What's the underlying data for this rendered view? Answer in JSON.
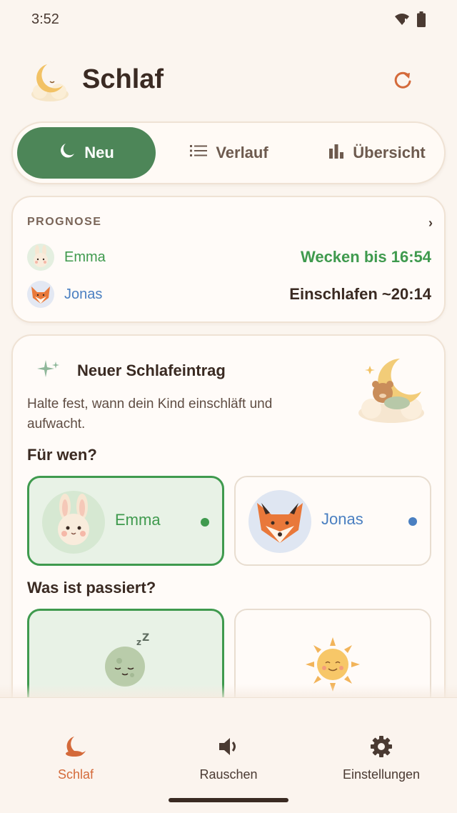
{
  "status_bar": {
    "time": "3:52",
    "wifi_icon": "wifi-icon",
    "battery_icon": "battery-icon"
  },
  "header": {
    "title": "Schlaf",
    "logo_icon": "moon-cloud-icon",
    "refresh_icon": "refresh-icon"
  },
  "tabs": [
    {
      "label": "Neu",
      "icon": "moon-icon",
      "active": true
    },
    {
      "label": "Verlauf",
      "icon": "list-icon",
      "active": false
    },
    {
      "label": "Übersicht",
      "icon": "bar-chart-icon",
      "active": false
    }
  ],
  "forecast": {
    "heading": "PROGNOSE",
    "rows": [
      {
        "name": "Emma",
        "prediction": "Wecken bis 16:54",
        "name_color": "#3f9a4e",
        "prediction_color": "#3f9a4e"
      },
      {
        "name": "Jonas",
        "prediction": "Einschlafen ~20:14",
        "name_color": "#4a7fc1",
        "prediction_color": "#3a2a22"
      }
    ]
  },
  "entry": {
    "title": "Neuer Schlafeintrag",
    "description": "Halte fest, wann dein Kind einschläft und aufwacht.",
    "who_question": "Für wen?",
    "what_question": "Was ist passiert?",
    "children": [
      {
        "name": "Emma",
        "selected": true,
        "color": "#3f9a4e"
      },
      {
        "name": "Jonas",
        "selected": false,
        "color": "#4a7fc1"
      }
    ],
    "events": [
      {
        "icon": "sleeping-moon-icon",
        "selected": true
      },
      {
        "icon": "sun-icon",
        "selected": false
      }
    ]
  },
  "bottom_nav": [
    {
      "label": "Schlaf",
      "icon": "moon-icon",
      "active": true
    },
    {
      "label": "Rauschen",
      "icon": "speaker-icon",
      "active": false
    },
    {
      "label": "Einstellungen",
      "icon": "gear-icon",
      "active": false
    }
  ],
  "colors": {
    "accent_green": "#4d8658",
    "accent_orange": "#d46a3a",
    "background": "#fbf5ef"
  }
}
